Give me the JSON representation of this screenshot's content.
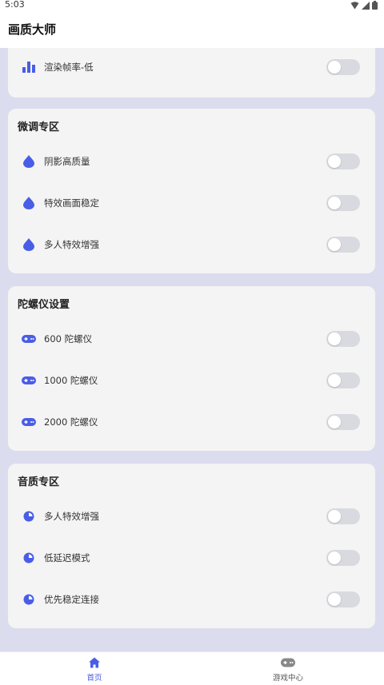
{
  "status_bar": {
    "time": "5:03"
  },
  "app_bar": {
    "title": "画质大师"
  },
  "colors": {
    "accent": "#4a5de6",
    "background": "#dcdcef",
    "card": "#f4f4f4",
    "toggle_off": "#d9dadf"
  },
  "render_card": {
    "items": [
      {
        "label": "渲染帧率-低",
        "icon": "bar-chart-icon",
        "enabled": false
      }
    ]
  },
  "tuning_card": {
    "title": "微调专区",
    "items": [
      {
        "label": "阴影高质量",
        "icon": "droplet-icon",
        "enabled": false
      },
      {
        "label": "特效画面稳定",
        "icon": "droplet-icon",
        "enabled": false
      },
      {
        "label": "多人特效增强",
        "icon": "droplet-icon",
        "enabled": false
      }
    ]
  },
  "gyro_card": {
    "title": "陀螺仪设置",
    "items": [
      {
        "label": "600 陀螺仪",
        "icon": "gamepad-icon",
        "enabled": false
      },
      {
        "label": "1000 陀螺仪",
        "icon": "gamepad-icon",
        "enabled": false
      },
      {
        "label": "2000 陀螺仪",
        "icon": "gamepad-icon",
        "enabled": false
      }
    ]
  },
  "audio_card": {
    "title": "音质专区",
    "items": [
      {
        "label": "多人特效增强",
        "icon": "pie-timer-icon",
        "enabled": false
      },
      {
        "label": "低延迟模式",
        "icon": "pie-timer-icon",
        "enabled": false
      },
      {
        "label": "优先稳定连接",
        "icon": "pie-timer-icon",
        "enabled": false
      }
    ]
  },
  "bottom_nav": {
    "items": [
      {
        "label": "首页",
        "icon": "home-icon",
        "active": true
      },
      {
        "label": "游戏中心",
        "icon": "gamepad-icon",
        "active": false
      }
    ]
  }
}
